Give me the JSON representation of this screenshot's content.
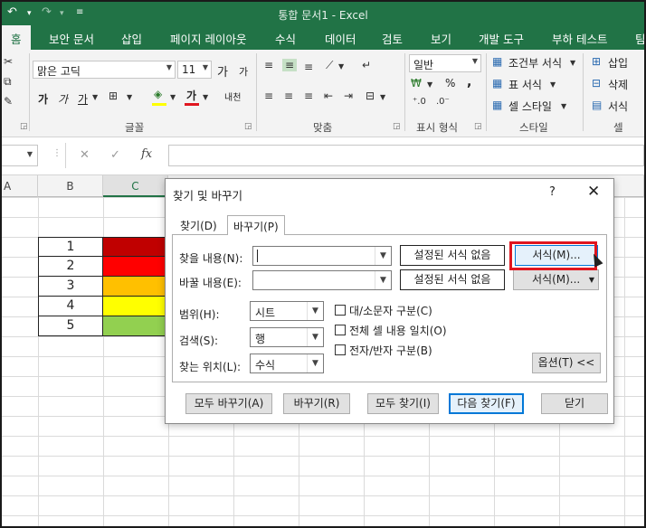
{
  "window": {
    "title": "통합 문서1 - Excel",
    "accent": "#217346"
  },
  "quick_access": {
    "undo_icon": "undo-icon",
    "redo_icon": "redo-icon",
    "customize_icon": "customize-icon"
  },
  "tabs": [
    "홈",
    "보안 문서",
    "삽입",
    "페이지 레이아웃",
    "수식",
    "데이터",
    "검토",
    "보기",
    "개발 도구",
    "부하 테스트",
    "팀"
  ],
  "ribbon": {
    "font_name": "맑은 고딕",
    "font_size": "11",
    "grow_font": "가",
    "shrink_font": "가",
    "bold": "가",
    "italic": "가",
    "underline": "가",
    "font_color_letter": "가",
    "phonetic": "내천",
    "number_format": "일반",
    "percent": "%",
    "comma": ",",
    "currency": "₩",
    "conditional_format": "조건부 서식",
    "table_format": "표 서식",
    "cell_style": "셀 스타일",
    "insert": "삽입",
    "delete": "삭제",
    "format": "서식",
    "groups": {
      "font": "글꼴",
      "alignment": "맞춤",
      "number": "표시 형식",
      "style": "스타일",
      "cells": "셀"
    }
  },
  "formula_bar": {
    "fx": "fx",
    "cancel": "✕",
    "enter": "✓",
    "value": ""
  },
  "sheet": {
    "columns": [
      "A",
      "B",
      "C"
    ],
    "rows": [
      {
        "num": "1",
        "color": "#c00000"
      },
      {
        "num": "2",
        "color": "#ff0000"
      },
      {
        "num": "3",
        "color": "#ffc000"
      },
      {
        "num": "4",
        "color": "#ffff00"
      },
      {
        "num": "5",
        "color": "#92d050"
      }
    ]
  },
  "dialog": {
    "title": "찾기 및 바꾸기",
    "help": "?",
    "close": "✕",
    "tabs": [
      "찾기(D)",
      "바꾸기(P)"
    ],
    "find_label": "찾을 내용(N):",
    "replace_label": "바꿀 내용(E):",
    "find_value": "",
    "replace_value": "",
    "no_format_find": "설정된 서식 없음",
    "no_format_replace": "설정된 서식 없음",
    "format_find": "서식(M)...",
    "format_replace": "서식(M)...",
    "scope_label": "범위(H):",
    "scope_value": "시트",
    "search_label": "검색(S):",
    "search_value": "행",
    "lookin_label": "찾는 위치(L):",
    "lookin_value": "수식",
    "match_case": "대/소문자 구분(C)",
    "match_entire": "전체 셀 내용 일치(O)",
    "match_byte": "전자/반자 구분(B)",
    "options": "옵션(T) <<",
    "replace_all": "모두 바꾸기(A)",
    "replace": "바꾸기(R)",
    "find_all": "모두 찾기(I)",
    "find_next": "다음 찾기(F)",
    "close_btn": "닫기"
  }
}
